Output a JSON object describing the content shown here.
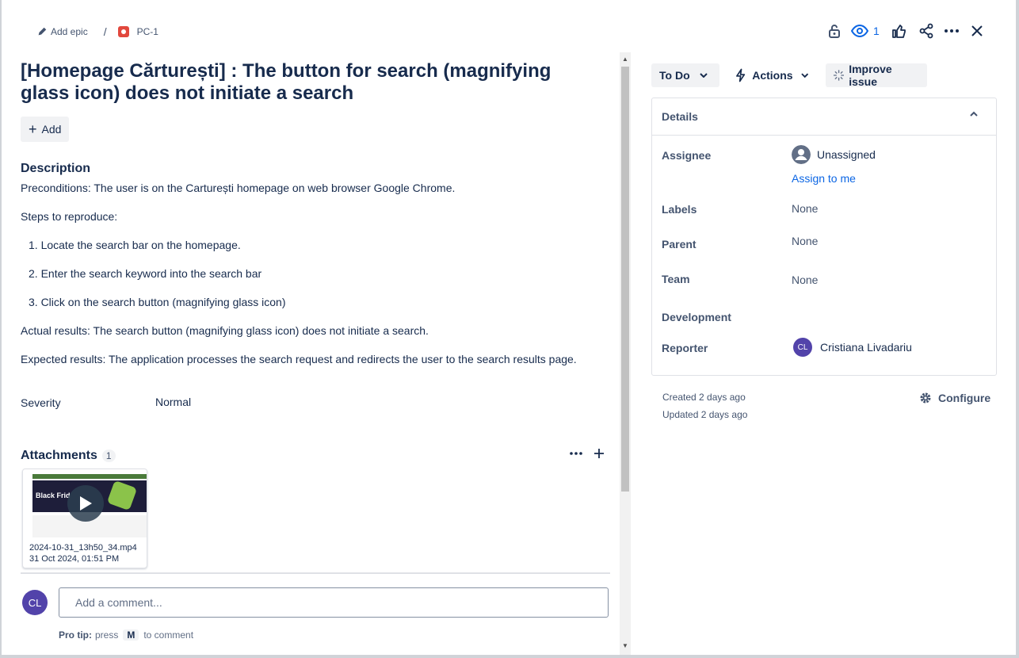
{
  "breadcrumb": {
    "add_epic": "Add epic",
    "separator": "/",
    "issue_key": "PC-1"
  },
  "header": {
    "watch_count": "1"
  },
  "issue": {
    "title": "[Homepage Cărturești] : The button for search (magnifying glass icon) does not initiate a search",
    "add_label": "Add"
  },
  "description": {
    "heading": "Description",
    "preconditions": "Preconditions: The user is on the Carturești homepage on web browser Google Chrome.",
    "steps_heading": "Steps to reproduce:",
    "steps": [
      "1. Locate the search bar on the homepage.",
      "2. Enter the search keyword into the search bar",
      "3. Click on the search button (magnifying glass icon)"
    ],
    "actual": "Actual results: The search button (magnifying glass icon)  does not initiate a search.",
    "expected": "Expected results: The application processes the search request and redirects the user to the search results page."
  },
  "severity": {
    "label": "Severity",
    "value": "Normal"
  },
  "attachments": {
    "heading": "Attachments",
    "count": "1",
    "items": [
      {
        "name": "2024-10-31_13h50_34.mp4",
        "date": "31 Oct 2024, 01:51 PM",
        "thumb_text": "Black Frid"
      }
    ]
  },
  "comment": {
    "avatar_initials": "CL",
    "placeholder": "Add a comment...",
    "protip_bold": "Pro tip:",
    "protip_press": "press",
    "protip_key": "M",
    "protip_rest": "to comment"
  },
  "status_bar": {
    "status": "To Do",
    "actions": "Actions",
    "improve": "Improve issue"
  },
  "details": {
    "heading": "Details",
    "assignee_label": "Assignee",
    "assignee_value": "Unassigned",
    "assign_to_me": "Assign to me",
    "labels_label": "Labels",
    "labels_value": "None",
    "parent_label": "Parent",
    "parent_value": "None",
    "team_label": "Team",
    "team_value": "None",
    "development_label": "Development",
    "reporter_label": "Reporter",
    "reporter_initials": "CL",
    "reporter_name": "Cristiana Livadariu"
  },
  "meta": {
    "created": "Created 2 days ago",
    "updated": "Updated 2 days ago",
    "configure": "Configure"
  },
  "colors": {
    "link": "#0c66e4",
    "avatar": "#5243aa",
    "bug": "#e2483d"
  }
}
